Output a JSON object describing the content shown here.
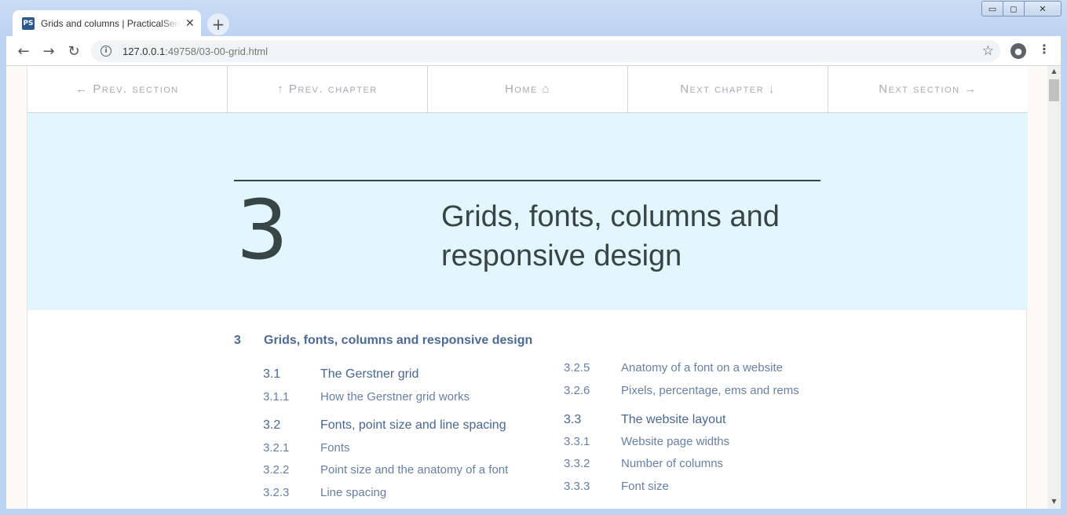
{
  "browser": {
    "tab_title": "Grids and columns | PracticalSeries",
    "tab_close": "✕",
    "new_tab": "+",
    "favicon": "PS",
    "url_host": "127.0.0.1",
    "url_path": ":49758/03-00-grid.html",
    "window_controls": {
      "minimize": "▭",
      "maximize": "◻",
      "close": "✕"
    },
    "icons": {
      "back": "←",
      "forward": "→",
      "reload": "↻",
      "info": "i",
      "star": "☆",
      "profile": "●",
      "menu": "⋮"
    }
  },
  "site_nav": [
    {
      "label": "← Prev. section"
    },
    {
      "label": "↑ Prev. chapter"
    },
    {
      "label": "Home ⌂"
    },
    {
      "label": "Next chapter ↓"
    },
    {
      "label": "Next section →"
    }
  ],
  "hero": {
    "chapter_number": "3",
    "chapter_title": "Grids, fonts, columns and responsive design"
  },
  "toc": {
    "chapter": {
      "num": "3",
      "title": "Grids, fonts, columns and responsive design"
    },
    "left": [
      {
        "num": "3.1",
        "title": "The Gerstner grid",
        "level": "sec"
      },
      {
        "num": "3.1.1",
        "title": "How the Gerstner grid works",
        "level": "sub"
      },
      {
        "num": "3.2",
        "title": "Fonts, point size and line spacing",
        "level": "sec"
      },
      {
        "num": "3.2.1",
        "title": "Fonts",
        "level": "sub"
      },
      {
        "num": "3.2.2",
        "title": "Point size and the anatomy of a font",
        "level": "sub"
      },
      {
        "num": "3.2.3",
        "title": "Line spacing",
        "level": "sub"
      }
    ],
    "right": [
      {
        "num": "3.2.5",
        "title": "Anatomy of a font on a website",
        "level": "sub"
      },
      {
        "num": "3.2.6",
        "title": "Pixels, percentage, ems and rems",
        "level": "sub"
      },
      {
        "num": "3.3",
        "title": "The website layout",
        "level": "sec"
      },
      {
        "num": "3.3.1",
        "title": "Website page widths",
        "level": "sub"
      },
      {
        "num": "3.3.2",
        "title": "Number of columns",
        "level": "sub"
      },
      {
        "num": "3.3.3",
        "title": "Font size",
        "level": "sub"
      }
    ]
  },
  "scrollbar": {
    "up": "▲",
    "down": "▼"
  }
}
